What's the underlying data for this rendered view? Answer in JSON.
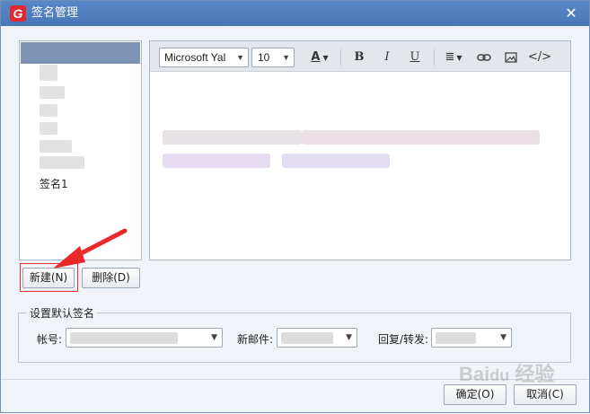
{
  "window": {
    "title": "签名管理",
    "logo_letter": "G"
  },
  "signature_list": {
    "items": [
      {
        "label": "签名1"
      }
    ]
  },
  "toolbar": {
    "font_family": "Microsoft Yal",
    "font_size": "10",
    "font_color_icon": "font-color-icon",
    "bold": "B",
    "italic": "I",
    "underline": "U"
  },
  "buttons": {
    "new": "新建(N)",
    "delete": "删除(D)",
    "ok": "确定(O)",
    "cancel": "取消(C)"
  },
  "default_signature": {
    "legend": "设置默认签名",
    "account_label": "帐号:",
    "new_mail_label": "新邮件:",
    "reply_forward_label": "回复/转发:"
  },
  "colors": {
    "title_bar": "#4f7fc0",
    "selection": "#7c93b6",
    "highlight_box": "#e23232",
    "arrow": "#ea2a2a"
  }
}
